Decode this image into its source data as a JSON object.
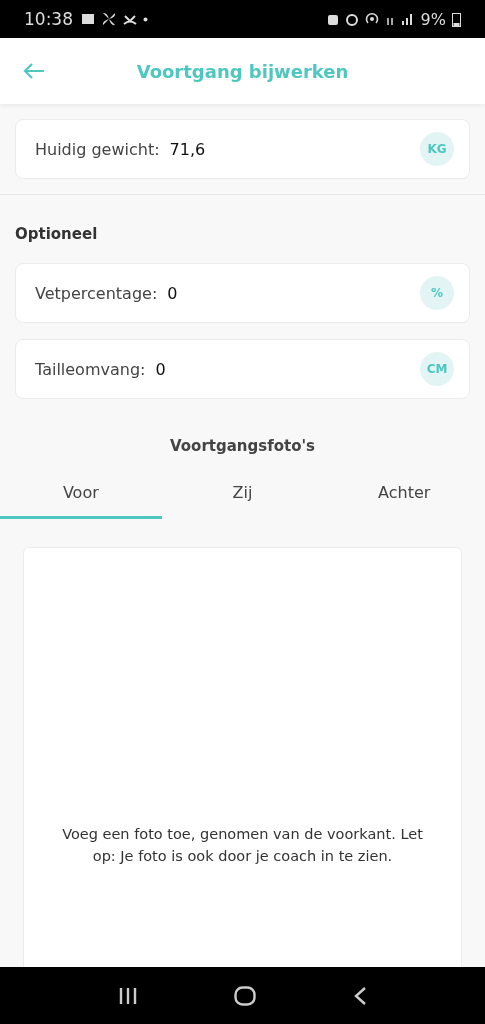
{
  "status_bar": {
    "time": "10:38",
    "battery": "9%"
  },
  "header": {
    "title": "Voortgang bijwerken"
  },
  "main_field": {
    "label": "Huidig gewicht:",
    "value": "71,6",
    "unit": "KG"
  },
  "optional": {
    "heading": "Optioneel",
    "fields": [
      {
        "label": "Vetpercentage:",
        "value": "0",
        "unit": "%"
      },
      {
        "label": "Tailleomvang:",
        "value": "0",
        "unit": "CM"
      }
    ]
  },
  "photos": {
    "heading": "Voortgangsfoto's",
    "tabs": [
      {
        "label": "Voor",
        "selected": true
      },
      {
        "label": "Zij",
        "selected": false
      },
      {
        "label": "Achter",
        "selected": false
      }
    ],
    "hint": "Voeg een foto toe, genomen van de voorkant. Let op: Je foto is ook door je coach in te zien."
  }
}
